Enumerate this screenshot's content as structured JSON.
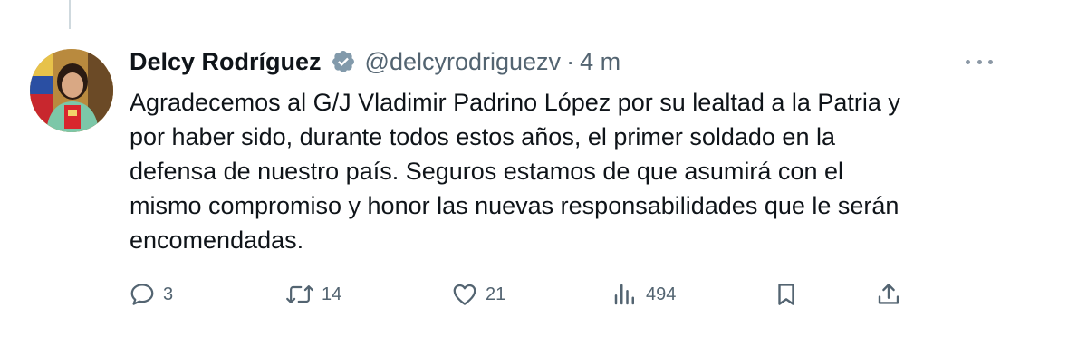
{
  "tweet": {
    "author_name": "Delcy Rodríguez",
    "handle": "@delcyrodriguezv",
    "separator": "·",
    "time": "4 m",
    "text": "Agradecemos al G/J Vladimir Padrino López por su lealtad a la Patria y\npor haber sido, durante todos estos años, el primer soldado en la\ndefensa de nuestro país. Seguros estamos de que asumirá con el\nmismo compromiso y honor las nuevas responsabilidades que le serán\nencomendadas.",
    "verified_badge_color": "#829aab"
  },
  "actions": {
    "reply": {
      "icon": "reply-icon",
      "count": "3"
    },
    "retweet": {
      "icon": "retweet-icon",
      "count": "14"
    },
    "like": {
      "icon": "heart-icon",
      "count": "21"
    },
    "views": {
      "icon": "views-icon",
      "count": "494"
    },
    "bookmark": {
      "icon": "bookmark-icon"
    },
    "share": {
      "icon": "share-icon"
    }
  },
  "colors": {
    "text": "#0f1419",
    "secondary": "#536471",
    "divider": "#eff3f4"
  }
}
